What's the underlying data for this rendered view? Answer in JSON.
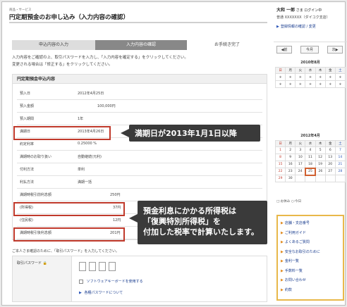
{
  "header": {
    "category": "商品・サービス",
    "title": "円定期預金のお申し込み（入力内容の確認）"
  },
  "steps": [
    "申込内容の入力",
    "入力内容の確認",
    "お手続き完了"
  ],
  "intro": [
    "入力内容をご確認の上、取引パスワードを入力し、「入力内容を確定する」をクリックしてください。",
    "変更される場合は「修正する」をクリックしてください。"
  ],
  "details": {
    "heading": "円定期預金申込内容",
    "rows": [
      {
        "label": "預入日",
        "value": "2012年4月25日"
      },
      {
        "label": "預入金額",
        "value": "100,000円"
      },
      {
        "label": "預入期間",
        "value": "1年"
      },
      {
        "label": "満期日",
        "value": "2013年4月26日"
      },
      {
        "label": "約定利率",
        "value": "0.25000 %"
      },
      {
        "label": "満期時のお取り扱い",
        "value": "自動継続(元利)"
      },
      {
        "label": "付利方法",
        "value": "単利"
      },
      {
        "label": "利払方法",
        "value": "満期一括"
      },
      {
        "label": "満期時税引前利息額",
        "value": "250円"
      },
      {
        "label": "(所得税)",
        "value": "37円"
      },
      {
        "label": "(住民税)",
        "value": "12円"
      },
      {
        "label": "満期時税引後利息額",
        "value": "201円"
      }
    ]
  },
  "callouts": {
    "maturity": "満期日が2013年1月1日以降",
    "tax": [
      "預金利息にかかる所得税は",
      "「復興特別所得税」を",
      "付加した税率で計算いたします。"
    ]
  },
  "password": {
    "note": "ご本人さま確認のために、「取引パスワード」を入力してください。",
    "label": "取引パスワード",
    "software_keyboard": "ソフトウェアキーボードを使用する",
    "about_link": "各種パスワードについて"
  },
  "sidebar": {
    "user_name": "大和 一郎",
    "user_suffix": "さま",
    "login_label": "ログイン中",
    "account": "普通 XXXXXXX（ダイコク支店）",
    "reg_link": "登録情報の確認 / 変更",
    "nav": {
      "prev": "◀前",
      "mid": "今月",
      "next": "次▶"
    },
    "calendars": [
      {
        "title": "2010年8月"
      },
      {
        "title": "2012年4月"
      }
    ],
    "weekdays": [
      "日",
      "月",
      "火",
      "水",
      "木",
      "金",
      "土"
    ],
    "cal1": [
      [
        "＊",
        "＊",
        "＊",
        "＊",
        "＊",
        "＊",
        "＊"
      ],
      [
        "＊",
        "＊",
        "＊",
        "＊",
        "＊",
        "＊",
        "＊"
      ]
    ],
    "cal2": [
      [
        "1",
        "2",
        "3",
        "4",
        "5",
        "6",
        "7"
      ],
      [
        "8",
        "9",
        "10",
        "11",
        "12",
        "13",
        "14"
      ],
      [
        "15",
        "16",
        "17",
        "18",
        "19",
        "20",
        "21"
      ],
      [
        "22",
        "23",
        "24",
        "25",
        "26",
        "27",
        "28"
      ],
      [
        "29",
        "30",
        "",
        "",
        "",
        "",
        ""
      ]
    ],
    "legend": "□:お休み  ○:今日",
    "menu": [
      "店舗・支店番号",
      "ご利用ガイド",
      "よくあるご質問",
      "安全なお取引のために",
      "金利一覧",
      "手数料一覧",
      "お問い合わせ",
      "約款"
    ]
  },
  "colors": {
    "accent_red": "#c0392b",
    "callout_bg": "#3a3a3a",
    "menu_border": "#e8b84a"
  }
}
